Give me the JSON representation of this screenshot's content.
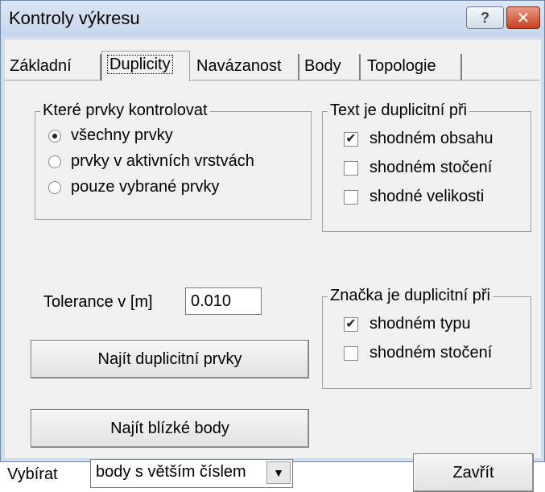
{
  "window": {
    "title": "Kontroly výkresu"
  },
  "titlebar": {
    "help_icon": "question-icon",
    "help_glyph": "?",
    "close_icon": "close-icon",
    "close_glyph": "✕"
  },
  "tabs": [
    {
      "label": "Základní"
    },
    {
      "label": "Duplicity",
      "active": true
    },
    {
      "label": "Navázanost"
    },
    {
      "label": "Body"
    },
    {
      "label": "Topologie"
    }
  ],
  "which_elements": {
    "legend": "Které prvky kontrolovat",
    "options": [
      {
        "label": "všechny prvky",
        "selected": true
      },
      {
        "label": "prvky v aktivních vrstvách",
        "selected": false
      },
      {
        "label": "pouze vybrané prvky",
        "selected": false
      }
    ]
  },
  "text_duplicate": {
    "legend": "Text je duplicitní při",
    "options": [
      {
        "label": "shodném obsahu",
        "checked": true
      },
      {
        "label": "shodném stočení",
        "checked": false
      },
      {
        "label": "shodné velikosti",
        "checked": false
      }
    ]
  },
  "symbol_duplicate": {
    "legend": "Značka je duplicitní při",
    "options": [
      {
        "label": "shodném typu",
        "checked": true
      },
      {
        "label": "shodném stočení",
        "checked": false
      }
    ]
  },
  "tolerance": {
    "label": "Tolerance  v [m]",
    "value": "0.010"
  },
  "buttons": {
    "find_duplicates": "Najít duplicitní prvky",
    "find_near_points": "Najít blízké body",
    "close": "Zavřít"
  },
  "select_mode": {
    "label": "Vybírat",
    "value": "body s větším číslem",
    "arrow_glyph": "▼"
  },
  "check_glyph": "✔"
}
